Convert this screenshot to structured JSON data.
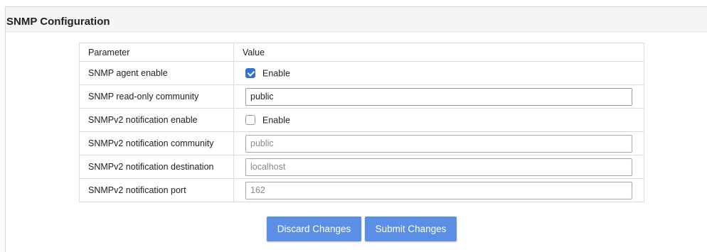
{
  "panel": {
    "title": "SNMP Configuration"
  },
  "table": {
    "headers": {
      "parameter": "Parameter",
      "value": "Value"
    },
    "rows": {
      "agent_enable": {
        "label": "SNMP agent enable",
        "checked": true,
        "checkbox_label": "Enable"
      },
      "ro_community": {
        "label": "SNMP read-only community",
        "value": "public"
      },
      "v2_notif_enable": {
        "label": "SNMPv2 notification enable",
        "checked": false,
        "checkbox_label": "Enable"
      },
      "v2_notif_community": {
        "label": "SNMPv2 notification community",
        "value": "public"
      },
      "v2_notif_destination": {
        "label": "SNMPv2 notification destination",
        "value": "localhost"
      },
      "v2_notif_port": {
        "label": "SNMPv2 notification port",
        "value": "162"
      }
    }
  },
  "actions": {
    "discard_label": "Discard Changes",
    "submit_label": "Submit Changes"
  },
  "colors": {
    "accent": "#2f72d6",
    "button": "#5b8fe6",
    "header_bg": "#f5f5f5"
  }
}
